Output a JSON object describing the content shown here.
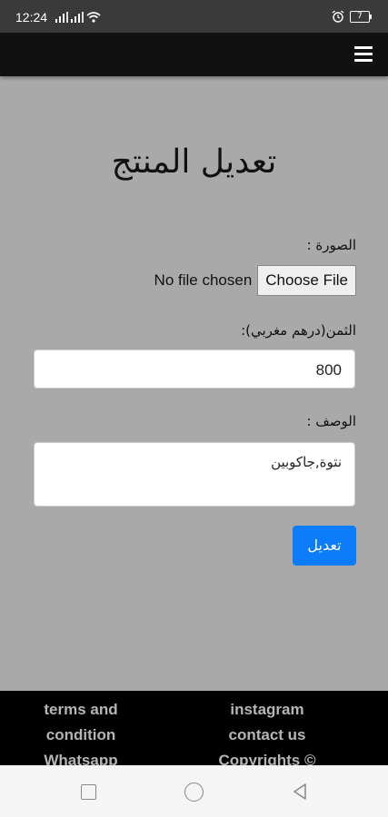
{
  "status_bar": {
    "time": "12:24",
    "battery": "7"
  },
  "page": {
    "title": "تعديل المنتج"
  },
  "form": {
    "image_label": "الصورة :",
    "file_status": "No file chosen",
    "file_button": "Choose File",
    "price_label": "الثمن(درهم مغربي):",
    "price_value": "800",
    "description_label": "الوصف :",
    "description_value": "نتوة,جاكوبين",
    "submit_label": "تعديل"
  },
  "footer": {
    "links": [
      "terms and",
      "condition",
      "Whatsapp",
      "instagram",
      "contact us",
      "Copyrights ©"
    ]
  },
  "colors": {
    "page_background": "#a9a9a9",
    "navbar": "#111111",
    "footer": "#000000",
    "submit_button": "#0d7cf8"
  },
  "icons": {
    "menu": "hamburger-menu-icon",
    "alarm": "alarm-icon",
    "wifi": "wifi-icon",
    "signal": "signal-icon",
    "battery": "battery-icon",
    "recents": "recents-square-icon",
    "home": "home-circle-icon",
    "back": "back-triangle-icon"
  }
}
